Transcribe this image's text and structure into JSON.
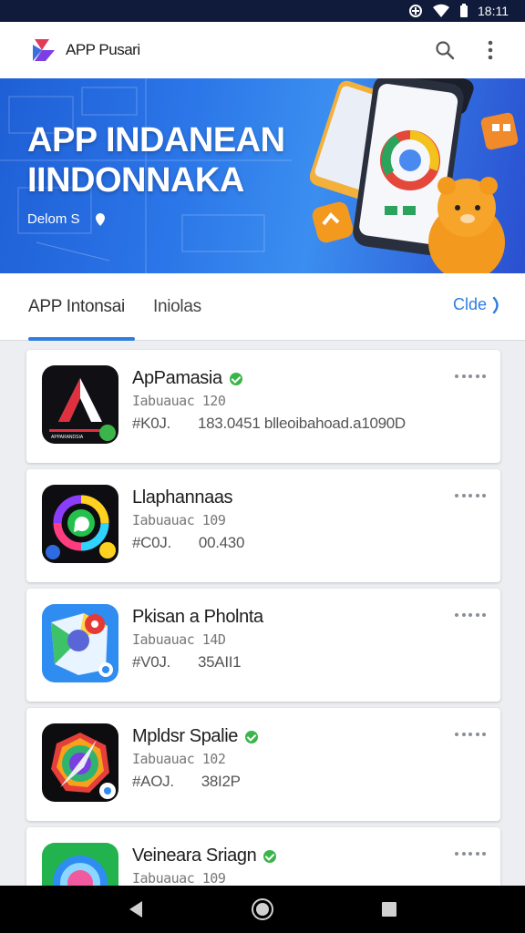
{
  "status_bar": {
    "time": "18:11",
    "icons": [
      "data-saver-icon",
      "wifi-icon",
      "battery-icon"
    ]
  },
  "app_bar": {
    "title": "APP Pusari",
    "logo": "app-pusari-logo",
    "actions": [
      "search-icon",
      "more-vert-icon"
    ]
  },
  "banner": {
    "title_line1": "APP INDANEAN",
    "title_line2": "IINDONNAKA",
    "subtitle": "Delom S",
    "subtitle_icon": "pin-icon"
  },
  "tabs": {
    "items": [
      {
        "label": "APP Intonsai",
        "active": true
      },
      {
        "label": "Iniolas",
        "active": false
      }
    ],
    "more_label": "Clde"
  },
  "apps": [
    {
      "name": "ApPamasia",
      "verified": true,
      "meta": "Iabuauac 120",
      "stat1": "#K0J.",
      "stat2": "183.0451 blleoibahoad.a1090D",
      "icon": "triangle-app-icon",
      "icon_label": "APPARANDSIA"
    },
    {
      "name": "Llaphannaas",
      "verified": false,
      "meta": "Iabuauac 109",
      "stat1": "#C0J.",
      "stat2": "00.430",
      "icon": "ring-app-icon",
      "icon_label": ""
    },
    {
      "name": "Pkisan a Pholnta",
      "verified": false,
      "meta": "Iabuauac 14D",
      "stat1": "#V0J.",
      "stat2": "35AII1",
      "icon": "map-pin-app-icon",
      "icon_label": ""
    },
    {
      "name": "Mpldsr Spalie",
      "verified": true,
      "meta": "Iabuauac 102",
      "stat1": "#AOJ.",
      "stat2": "38I2P",
      "icon": "compass-app-icon",
      "icon_label": ""
    },
    {
      "name": "Veineara Sriagn",
      "verified": true,
      "meta": "Iabuauac 109",
      "stat1": "",
      "stat2": "",
      "icon": "location-app-icon",
      "icon_label": ""
    }
  ],
  "nav_bar": {
    "buttons": [
      "back-icon",
      "home-icon",
      "recents-icon"
    ]
  },
  "colors": {
    "accent": "#2f7de1",
    "banner_start": "#1f5fd6",
    "banner_end": "#2a4fd0",
    "verified": "#3bb54a",
    "status_bar": "#101a3a"
  }
}
